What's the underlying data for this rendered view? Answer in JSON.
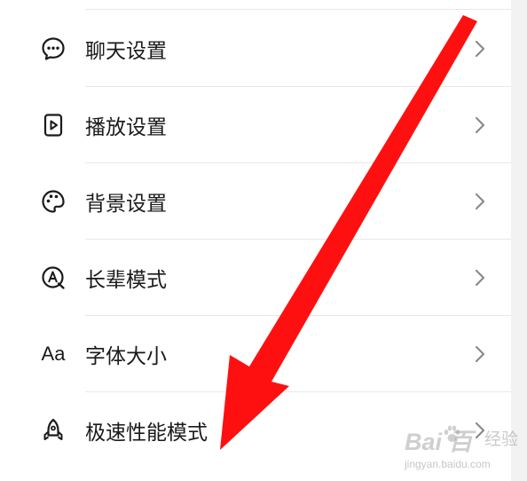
{
  "settings_list": {
    "items": [
      {
        "label": "聊天设置",
        "icon": "chat-bubble-icon"
      },
      {
        "label": "播放设置",
        "icon": "play-icon"
      },
      {
        "label": "背景设置",
        "icon": "palette-icon"
      },
      {
        "label": "长辈模式",
        "icon": "elder-mode-icon"
      },
      {
        "label": "字体大小",
        "icon": "font-size-icon",
        "icon_text": "Aa"
      },
      {
        "label": "极速性能模式",
        "icon": "rocket-icon"
      }
    ],
    "chevron_icon": "chevron-right-icon"
  },
  "annotation": {
    "arrow_color": "#ff1010",
    "arrow_icon": "red-arrow-icon"
  },
  "watermark": {
    "logo": "Bai 百",
    "suffix": "经验",
    "url": "jingyan.baidu.com"
  }
}
